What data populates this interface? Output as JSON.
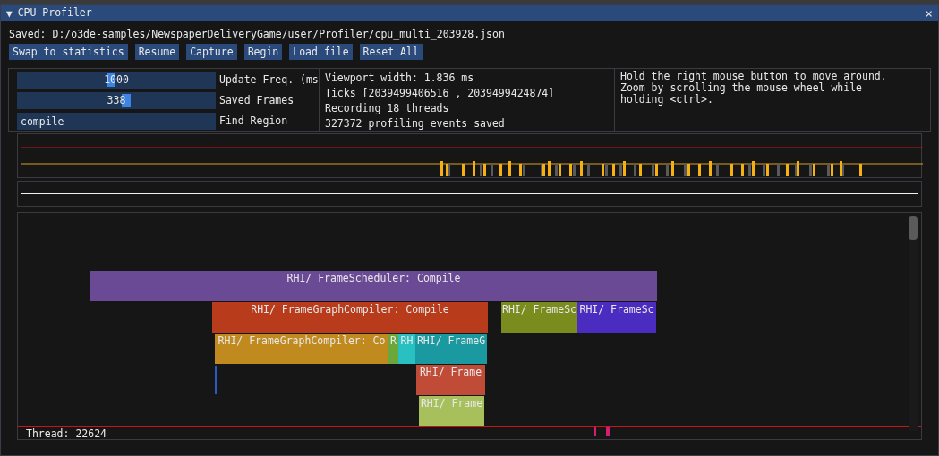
{
  "window": {
    "title": "CPU Profiler",
    "collapse_glyph": "▼",
    "close_glyph": "×"
  },
  "saved_path": "Saved: D:/o3de-samples/NewspaperDeliveryGame/user/Profiler/cpu_multi_203928.json",
  "buttons": [
    "Swap to statistics",
    "Resume",
    "Capture",
    "Begin",
    "Load file",
    "Reset All"
  ],
  "controls": [
    {
      "kind": "slider",
      "value": "1000",
      "label": "Update Freq. (ms",
      "level": 0.47
    },
    {
      "kind": "slider",
      "value": "338",
      "label": "Saved Frames",
      "level": 0.55
    },
    {
      "kind": "text",
      "value": "compile",
      "label": "Find Region"
    }
  ],
  "info": [
    "Viewport width: 1.836 ms",
    "Ticks [2039499406516 , 2039499424874]",
    "Recording 18 threads",
    "327372 profiling events saved"
  ],
  "hint": "Hold the right mouse button to move around. Zoom by scrolling the mouse wheel while holding <ctrl>.",
  "regions": [
    {
      "label": "RHI/ FrameScheduler: Compile",
      "color": "#6a4a94"
    },
    {
      "label": "RHI/ FrameGraphCompiler: Compile",
      "color": "#b83c1c"
    },
    {
      "label": "RHI/ FrameSc",
      "color": "#7a8c1e"
    },
    {
      "label": "RHI/ FrameSc",
      "color": "#4a2cc0"
    },
    {
      "label": "RHI/ FrameGraphCompiler: Co",
      "color": "#c08a1e"
    },
    {
      "label": "R",
      "color": "#6aa83c"
    },
    {
      "label": "RH",
      "color": "#28c0c0"
    },
    {
      "label": "RHI/ FrameG",
      "color": "#1a9aa0"
    },
    {
      "label": "RHI/ Frame",
      "color": "#c04c38"
    },
    {
      "label": "RHI/ Frame",
      "color": "#a8c05c"
    }
  ],
  "thread_label": "Thread: 22624"
}
